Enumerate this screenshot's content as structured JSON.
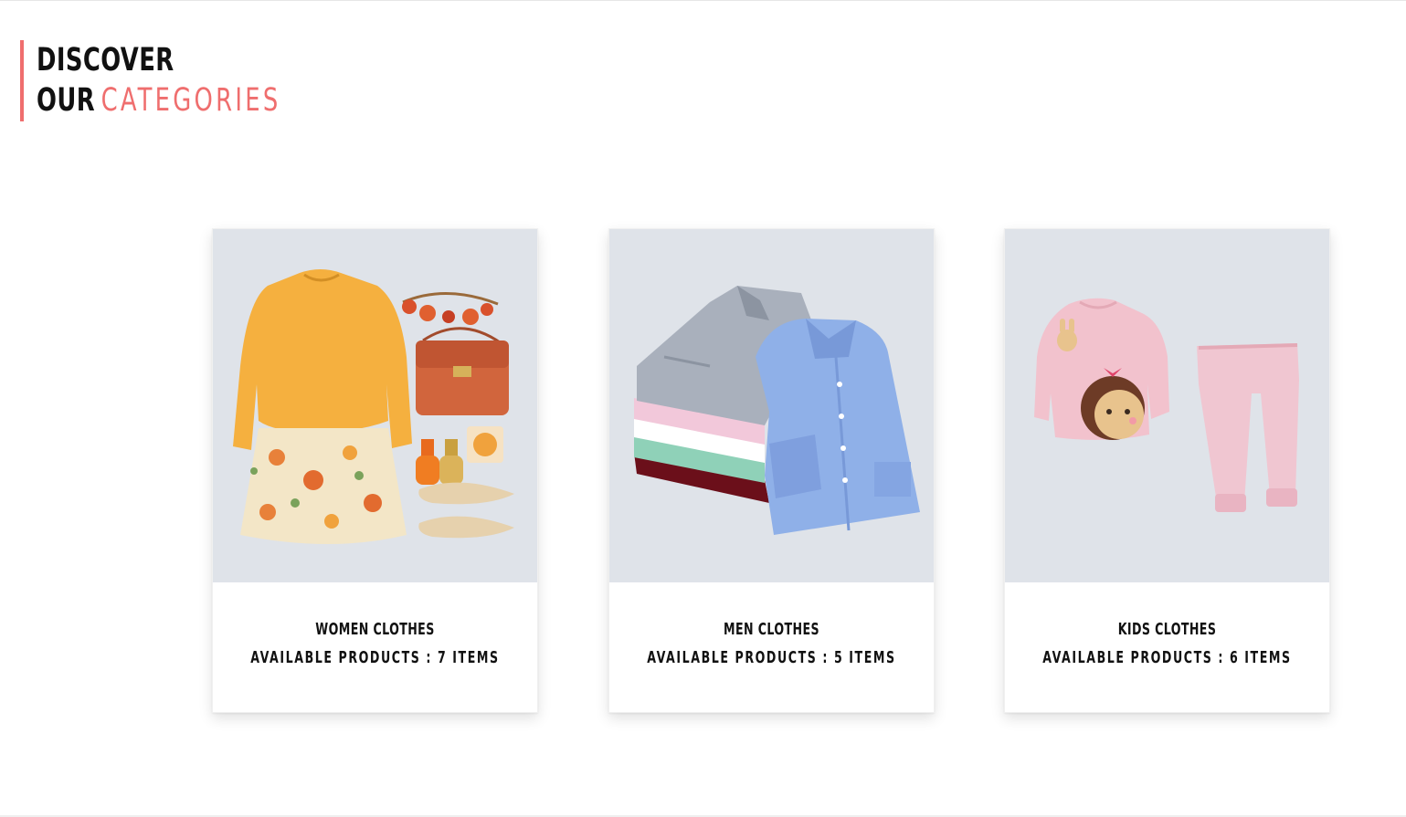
{
  "heading": {
    "line1": "DISCOVER",
    "line2_prefix": "OUR",
    "line2_accent": "CATEGORIES"
  },
  "colors": {
    "accent": "#ef6e6e",
    "card_image_bg": "#dfe3e9",
    "text": "#111111"
  },
  "categories": [
    {
      "title": "WOMEN CLOTHES",
      "count_text": "AVAILABLE PRODUCTS : 7 ITEMS",
      "image_icon": "women-outfit-image"
    },
    {
      "title": "MEN CLOTHES",
      "count_text": "AVAILABLE PRODUCTS : 5 ITEMS",
      "image_icon": "men-shirts-image"
    },
    {
      "title": "KIDS CLOTHES",
      "count_text": "AVAILABLE PRODUCTS : 6 ITEMS",
      "image_icon": "kids-pajamas-image"
    }
  ]
}
